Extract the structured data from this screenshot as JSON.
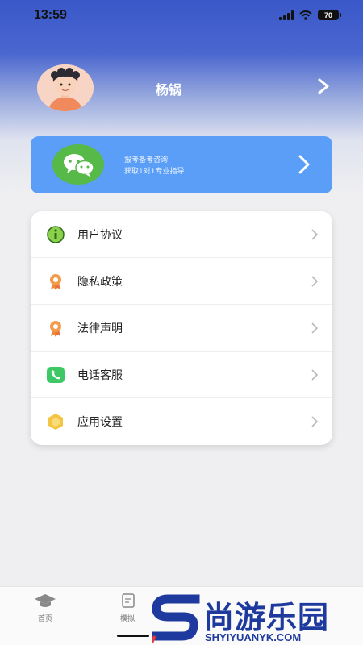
{
  "status_bar": {
    "time": "13:59",
    "battery": "70"
  },
  "profile": {
    "name": "杨锅"
  },
  "banner": {
    "line1": "报考备考咨询",
    "line2": "获取1对1专业指导"
  },
  "menu": [
    {
      "label": "用户协议",
      "icon": "info-icon"
    },
    {
      "label": "隐私政策",
      "icon": "badge-icon"
    },
    {
      "label": "法律声明",
      "icon": "badge-icon"
    },
    {
      "label": "电话客服",
      "icon": "phone-icon"
    },
    {
      "label": "应用设置",
      "icon": "settings-icon"
    }
  ],
  "tabs": [
    {
      "label": "首页",
      "icon": "graduation-cap-icon"
    },
    {
      "label": "模拟",
      "icon": "exam-paper-icon"
    }
  ],
  "watermark": {
    "text": "尚游乐园",
    "sub": "SHYIYUANYK.COM"
  },
  "colors": {
    "header": "#3a58c9",
    "banner": "#5a9ef7",
    "wechat": "#56b948",
    "watermark": "#1f3a9e"
  }
}
